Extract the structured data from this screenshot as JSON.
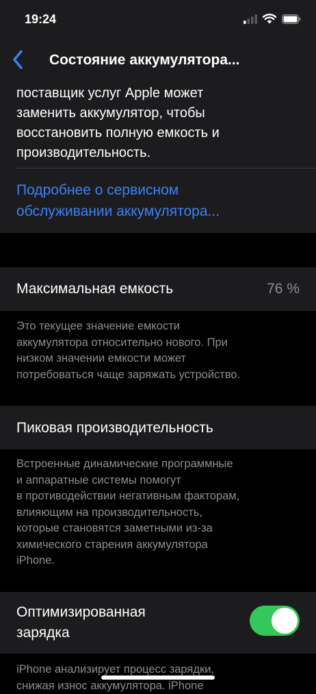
{
  "status_bar": {
    "time": "19:24"
  },
  "nav": {
    "title": "Состояние аккумулятора..."
  },
  "top_card": {
    "text_lines": [
      "поставщик услуг Apple может",
      "заменить аккумулятор, чтобы",
      "восстановить полную емкость и",
      "производительность."
    ],
    "link_lines": [
      "Подробнее о сервисном",
      "обслуживании аккумулятора..."
    ]
  },
  "max_capacity": {
    "label": "Максимальная емкость",
    "value": "76 %",
    "footnote_lines": [
      "Это текущее значение емкости",
      "аккумулятора относительно нового. При",
      "низком значении емкости может",
      "потребоваться чаще заряжать устройство."
    ]
  },
  "peak_performance": {
    "label": "Пиковая производительность",
    "footnote_lines": [
      "Встроенные динамические программные",
      "и аппаратные системы помогут",
      "в противодействии негативным факторам,",
      "влияющим на производительность,",
      "которые становятся заметными из-за",
      "химического старения аккумулятора",
      "iPhone."
    ]
  },
  "optimized_charging": {
    "label_lines": [
      "Оптимизированная",
      "зарядка"
    ],
    "enabled": true,
    "footnote_lines": [
      "iPhone анализирует процесс зарядки,",
      "снижая износ аккумулятора. iPhone"
    ]
  },
  "colors": {
    "background": "#000000",
    "cell": "#1c1c1e",
    "accent_blue": "#3b82f6",
    "toggle_on": "#34c759",
    "secondary_text": "#8e8e93"
  },
  "icons": {
    "back": "chevron-left-icon",
    "signal": "cellular-signal-icon",
    "wifi": "wifi-icon",
    "battery": "battery-icon"
  }
}
